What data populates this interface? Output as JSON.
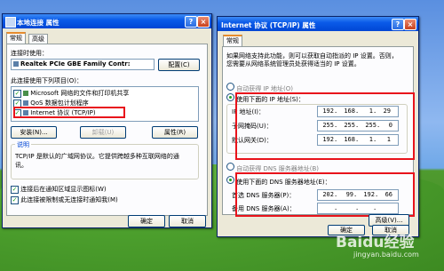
{
  "left_window": {
    "title": "本地连接 属性",
    "help_btn": "?",
    "close_btn": "×",
    "tabs": [
      "常规",
      "高级"
    ],
    "connect_using_label": "连接时使用：",
    "adapter_name": "Realtek PCIe GBE Family Contr:",
    "configure_button": "配置(C)",
    "items_label": "此连接使用下列项目(O)：",
    "items": [
      {
        "label": "Microsoft 网络的文件和打印机共享",
        "checked": true
      },
      {
        "label": "QoS 数据包计划程序",
        "checked": true
      },
      {
        "label": "Internet 协议 (TCP/IP)",
        "checked": true
      }
    ],
    "install_button": "安装(N)...",
    "uninstall_button": "卸载(U)",
    "properties_button": "属性(R)",
    "description_title": "说明",
    "description_text": "TCP/IP 是默认的广域网协议。它提供跨越多种互联网络的通讯。",
    "show_icon_label": "连接后在通知区域显示图标(W)",
    "notify_label": "此连接被限制或无连接时通知我(M)",
    "ok_button": "确定",
    "cancel_button": "取消"
  },
  "right_window": {
    "title": "Internet 协议 (TCP/IP) 属性",
    "help_btn": "?",
    "close_btn": "×",
    "tab": "常规",
    "intro_line1": "如果网络支持此功能，则可以获取自动指派的 IP 设置。否则，",
    "intro_line2": "您需要从网络系统管理员处获得适当的 IP 设置。",
    "auto_ip_label": "自动获得 IP 地址(O)",
    "manual_ip_label": "使用下面的 IP 地址(S)：",
    "ip_label": "IP 地址(I)：",
    "ip_value": [
      "192",
      "168",
      "1",
      "29"
    ],
    "mask_label": "子网掩码(U)：",
    "mask_value": [
      "255",
      "255",
      "255",
      "0"
    ],
    "gateway_label": "默认网关(D)：",
    "gateway_value": [
      "192",
      "168",
      "1",
      "1"
    ],
    "auto_dns_label": "自动获得 DNS 服务器地址(B)",
    "manual_dns_label": "使用下面的 DNS 服务器地址(E)：",
    "pref_dns_label": "首选 DNS 服务器(P)：",
    "pref_dns_value": [
      "202",
      "99",
      "192",
      "66"
    ],
    "alt_dns_label": "备用 DNS 服务器(A)：",
    "alt_dns_value": [
      "",
      "",
      "",
      ""
    ],
    "advanced_button": "高级(V)...",
    "ok_button": "确定",
    "cancel_button": "取消"
  },
  "watermark": "Baidu经验",
  "watermark_url": "jingyan.baidu.com",
  "colors": {
    "highlight_box": "#e8131b",
    "title_blue": "#0a5ae8",
    "window_bg": "#ece9d8"
  }
}
